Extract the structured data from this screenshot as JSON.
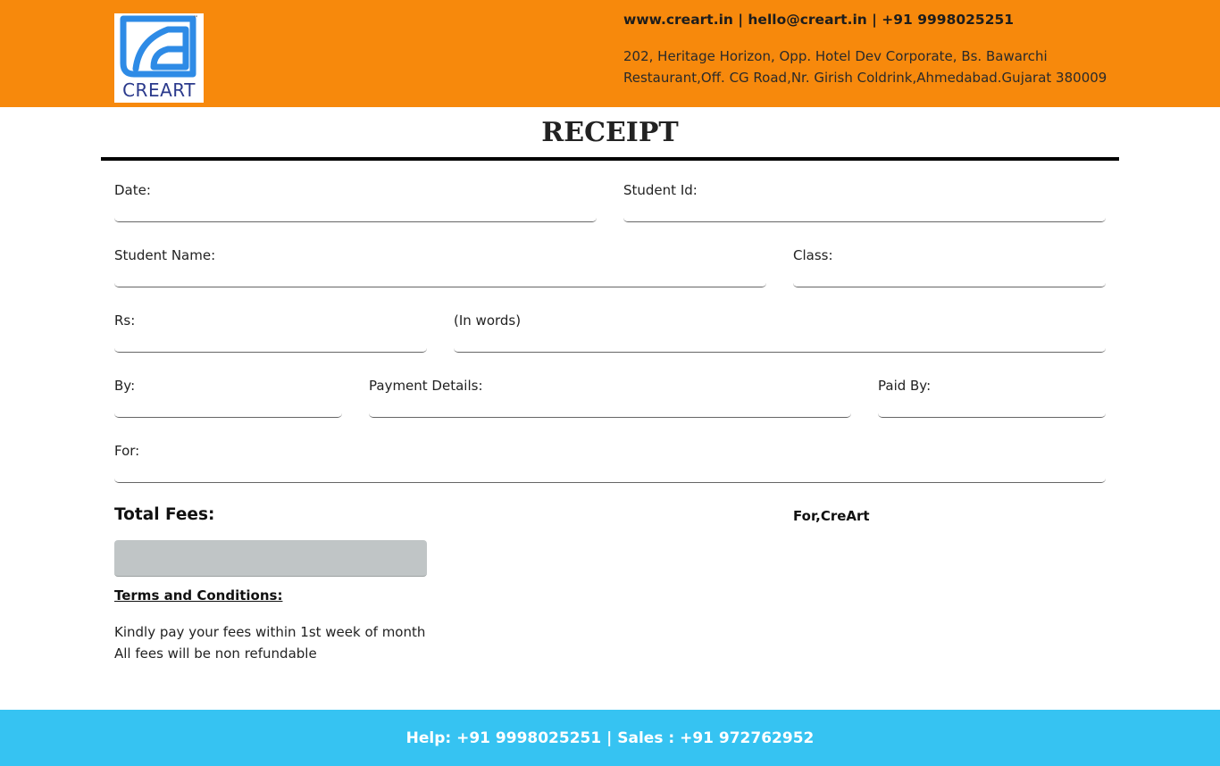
{
  "header": {
    "logo_text": "CREART",
    "trademark": "™",
    "contact": "www.creart.in | hello@creart.in | +91 9998025251",
    "address": "202, Heritage Horizon, Opp. Hotel Dev Corporate, Bs. Bawarchi Restaurant,Off. CG Road,Nr. Girish Coldrink,Ahmedabad.Gujarat 380009"
  },
  "title": "RECEIPT",
  "fields": {
    "date": "Date:",
    "student_id": "Student Id:",
    "student_name": "Student Name:",
    "class": "Class:",
    "rs": "Rs:",
    "in_words": "(In words)",
    "by": "By:",
    "payment_details": "Payment Details:",
    "paid_by": "Paid By:",
    "for": "For:"
  },
  "total_fees_label": "Total Fees:",
  "signature_label": "For,CreArt",
  "terms": {
    "title": "Terms and Conditions:",
    "text": "Kindly pay your fees within 1st week of month All fees will be non refundable"
  },
  "footer": {
    "text": "Help: +91 9998025251 | Sales : +91 972762952"
  },
  "colors": {
    "header_bg": "#f7890c",
    "footer_bg": "#36c3f2",
    "logo_blue": "#2e8be6"
  }
}
